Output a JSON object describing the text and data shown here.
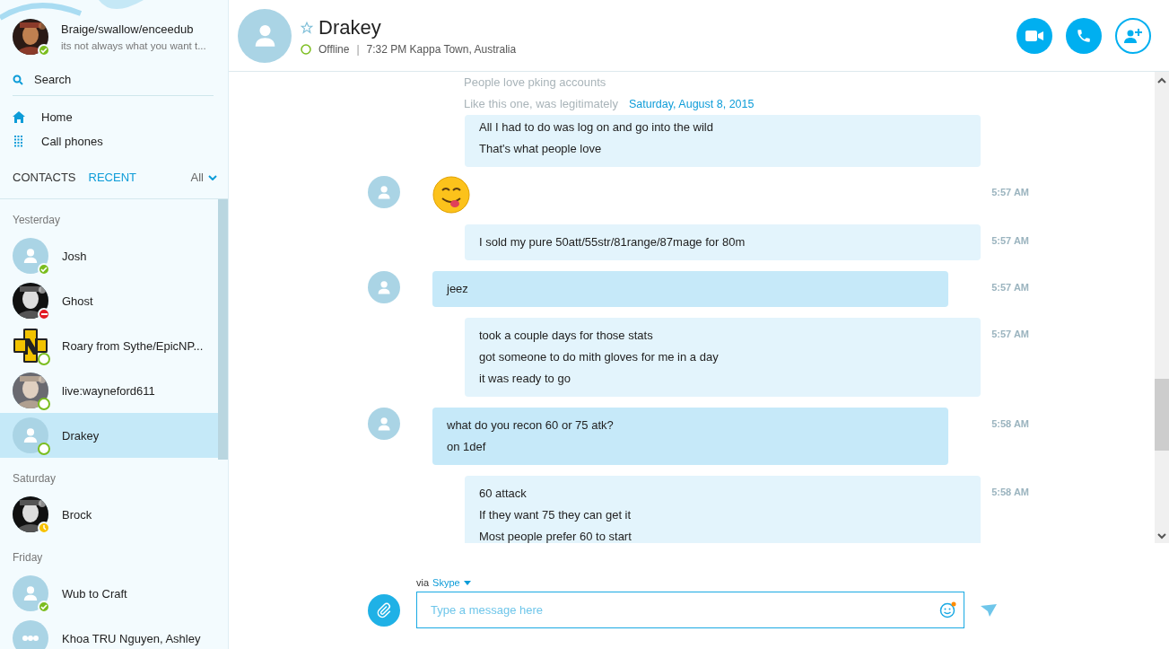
{
  "profile": {
    "name": "Braige/swallow/enceedub",
    "mood": "its not always what you want t...",
    "status_badge": {
      "kind": "online",
      "color": "#7bbd1e"
    }
  },
  "search": {
    "label": "Search"
  },
  "nav": [
    {
      "label": "Home",
      "kind": "home"
    },
    {
      "label": "Call phones",
      "kind": "dialpad"
    }
  ],
  "list_tabs": [
    {
      "label": "CONTACTS",
      "selected": false
    },
    {
      "label": "RECENT",
      "selected": true
    }
  ],
  "filter": {
    "label": "All"
  },
  "contact_groups": [
    {
      "heading": "Yesterday",
      "contacts": [
        {
          "name": "Josh",
          "kind": "default",
          "status_badge": {
            "kind": "online",
            "color": "#7bbd1e"
          },
          "selected": false
        },
        {
          "name": "Ghost",
          "kind": "picture",
          "status_badge": {
            "kind": "busy",
            "color": "#e21a23"
          },
          "selected": false
        },
        {
          "name": "Roary from Sythe/EpicNP...",
          "kind": "logo",
          "status_badge": {
            "kind": "offline",
            "color": "#7bbd1e"
          },
          "selected": false
        },
        {
          "name": "live:wayneford611",
          "kind": "picture",
          "status_badge": {
            "kind": "offline",
            "color": "#7bbd1e"
          },
          "selected": false
        },
        {
          "name": "Drakey",
          "kind": "default",
          "status_badge": {
            "kind": "offline",
            "color": "#7bbd1e"
          },
          "selected": true
        }
      ]
    },
    {
      "heading": "Saturday",
      "contacts": [
        {
          "name": "Brock",
          "kind": "picture",
          "status_badge": {
            "kind": "away",
            "color": "#f8c200"
          },
          "selected": false
        }
      ]
    },
    {
      "heading": "Friday",
      "contacts": [
        {
          "name": "Wub to Craft",
          "kind": "default",
          "status_badge": {
            "kind": "online",
            "color": "#7bbd1e"
          },
          "selected": false
        },
        {
          "name": "Khoa TRU Nguyen, Ashley",
          "kind": "group",
          "selected": false
        }
      ]
    }
  ],
  "chat_header": {
    "name": "Drakey",
    "favorite": false,
    "status_badge": {
      "kind": "offline",
      "color": "#7bbd1e"
    },
    "status_text": "Offline",
    "separator": "|",
    "local_time": "7:32 PM Kappa Town, Australia"
  },
  "header_actions": [
    {
      "kind": "video",
      "filled": true
    },
    {
      "kind": "call",
      "filled": true
    },
    {
      "kind": "add-person",
      "filled": false
    }
  ],
  "faded_lines": [
    "People love pking accounts",
    "Like this one, was legitimately"
  ],
  "date_divider": "Saturday, August 8, 2015",
  "messages": [
    {
      "outgoing": true,
      "kind": "text",
      "lines": [
        "All I had to do was log on and go into the wild",
        "That's what people love"
      ]
    },
    {
      "outgoing": false,
      "kind": "emoji",
      "time": "5:57 AM"
    },
    {
      "outgoing": true,
      "kind": "text",
      "lines": [
        "I sold my pure 50att/55str/81range/87mage for 80m"
      ],
      "time": "5:57 AM"
    },
    {
      "outgoing": false,
      "kind": "text",
      "lines": [
        "jeez"
      ],
      "time": "5:57 AM"
    },
    {
      "outgoing": true,
      "kind": "text",
      "lines": [
        "took a couple days for those stats",
        "got someone to do mith gloves for me in a day",
        "it was ready to go"
      ],
      "time": "5:57 AM"
    },
    {
      "outgoing": false,
      "kind": "text",
      "lines": [
        "what do you recon 60 or 75 atk?",
        "on 1def"
      ],
      "time": "5:58 AM"
    },
    {
      "outgoing": true,
      "kind": "text",
      "lines": [
        "60 attack",
        "If they want 75 they can get it",
        "Most people prefer 60 to start"
      ],
      "time": "5:58 AM"
    }
  ],
  "compose": {
    "via": "via",
    "service": "Skype",
    "placeholder": "Type a message here"
  }
}
